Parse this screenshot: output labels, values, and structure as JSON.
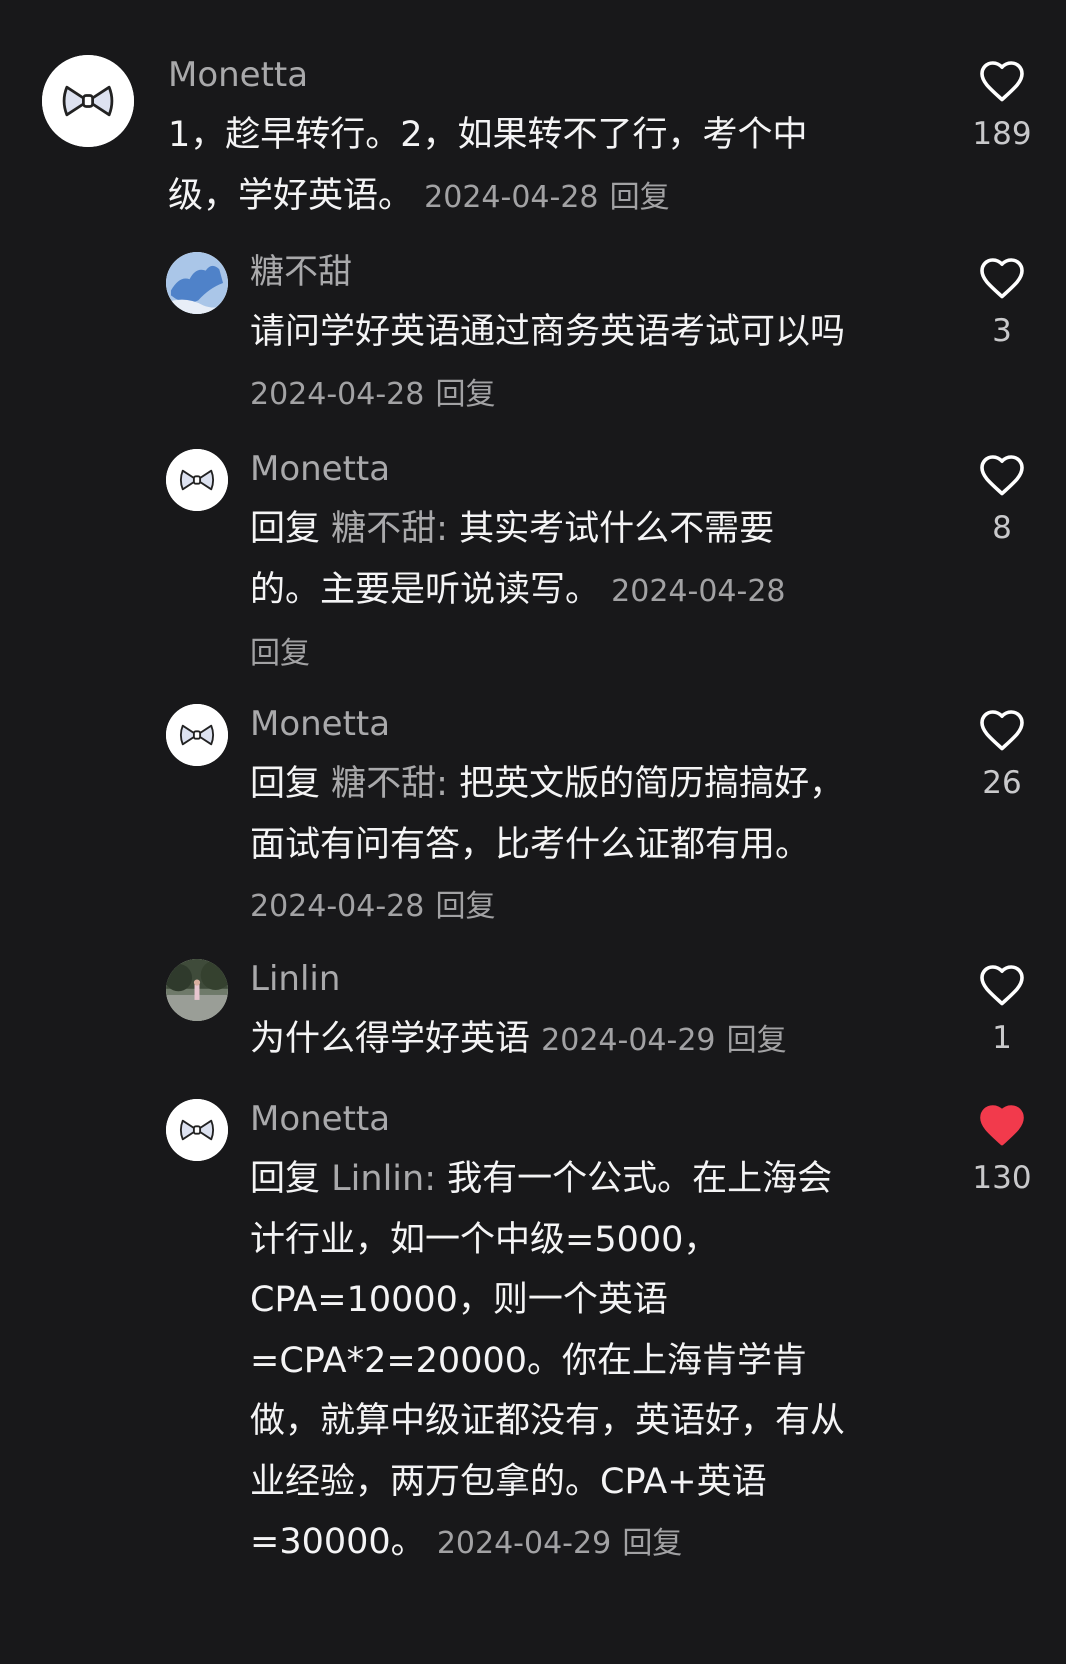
{
  "colors": {
    "background": "#18181a",
    "username": "#a9a9ab",
    "text": "#f4f4f5",
    "meta": "#a2a2a4",
    "like_outline": "#ffffff",
    "like_active": "#f23a4c"
  },
  "comments": [
    {
      "user": "Monetta",
      "avatar": "bow-avatar",
      "text": "1，趁早转行。2，如果转不了行，考个中级，学好英语。",
      "date": "2024-04-28",
      "reply": "回复",
      "likes": "189",
      "liked": false
    },
    {
      "user": "糖不甜",
      "avatar": "sky-avatar",
      "text": "请问学好英语通过商务英语考试可以吗",
      "date": "2024-04-28",
      "reply": "回复",
      "likes": "3",
      "liked": false
    },
    {
      "user": "Monetta",
      "avatar": "bow-avatar",
      "reply_prefix": "回复",
      "mention": "糖不甜:",
      "text": "其实考试什么不需要的。主要是听说读写。",
      "date": "2024-04-28",
      "reply": "回复",
      "likes": "8",
      "liked": false
    },
    {
      "user": "Monetta",
      "avatar": "bow-avatar",
      "reply_prefix": "回复",
      "mention": "糖不甜:",
      "text": "把英文版的简历搞搞好，面试有问有答，比考什么证都有用。",
      "date": "2024-04-28",
      "reply": "回复",
      "likes": "26",
      "liked": false
    },
    {
      "user": "Linlin",
      "avatar": "photo-avatar",
      "text": "为什么得学好英语",
      "date": "2024-04-29",
      "reply": "回复",
      "likes": "1",
      "liked": false
    },
    {
      "user": "Monetta",
      "avatar": "bow-avatar",
      "reply_prefix": "回复",
      "mention": "Linlin:",
      "text": "我有一个公式。在上海会计行业，如一个中级=5000，CPA=10000，则一个英语=CPA*2=20000。你在上海肯学肯做，就算中级证都没有，英语好，有从业经验，两万包拿的。CPA+英语=30000。",
      "date": "2024-04-29",
      "reply": "回复",
      "likes": "130",
      "liked": true
    }
  ]
}
